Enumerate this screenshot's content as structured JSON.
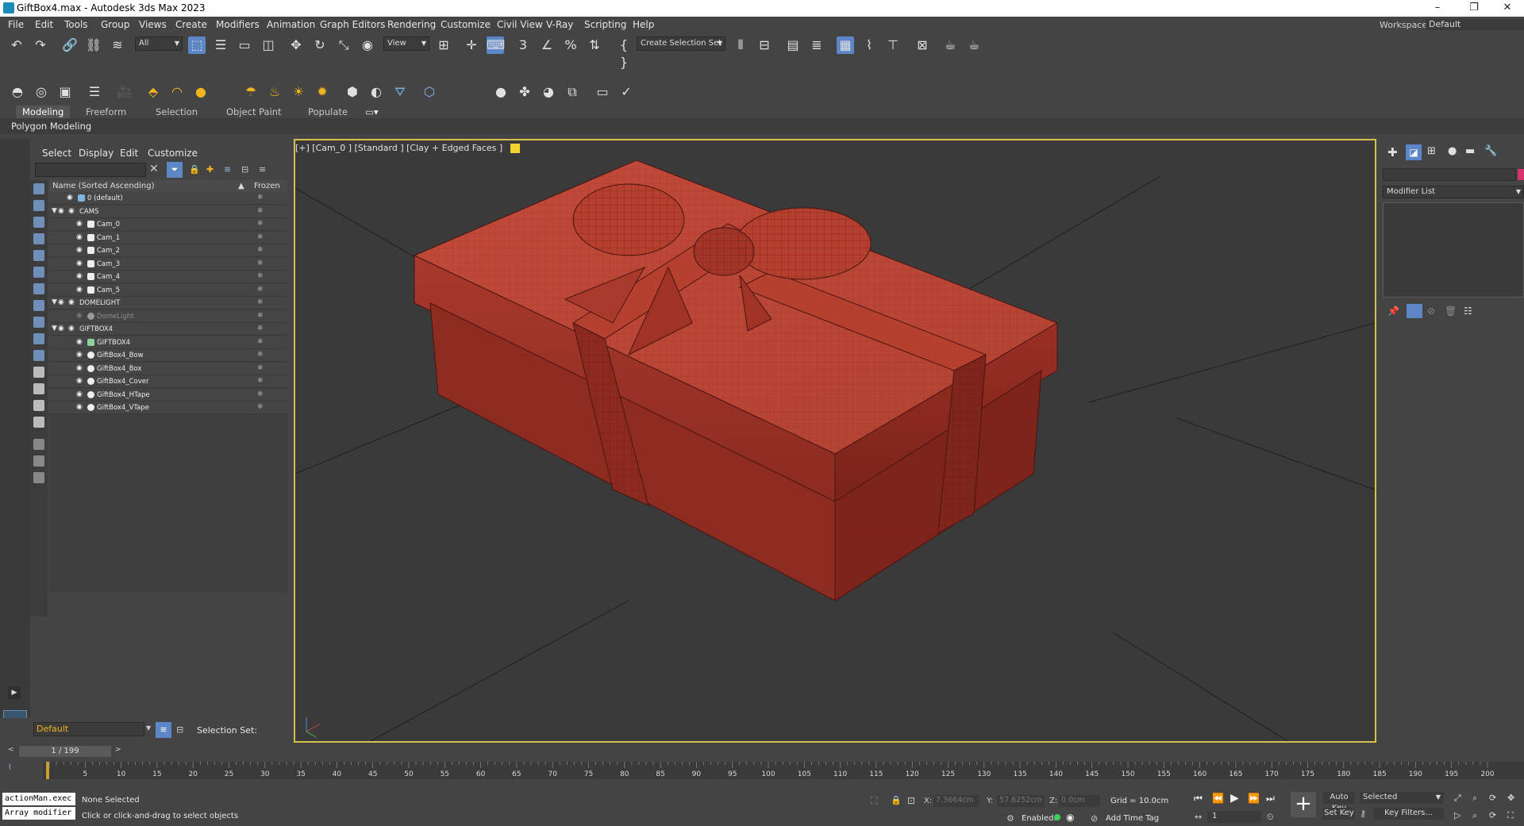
{
  "window": {
    "title": "GiftBox4.max - Autodesk 3ds Max 2023",
    "controls": [
      "–",
      "❐",
      "✕"
    ]
  },
  "menu": {
    "items": [
      "File",
      "Edit",
      "Tools",
      "Group",
      "Views",
      "Create",
      "Modifiers",
      "Animation",
      "Graph Editors",
      "Rendering",
      "Customize",
      "Civil View",
      "V-Ray",
      "Scripting",
      "Help"
    ],
    "workspaces_label": "Workspaces:",
    "workspaces_value": "Default"
  },
  "main_toolbar": {
    "filter_value": "All",
    "refcoord_value": "View",
    "selection_set_placeholder": "Create Selection Set"
  },
  "ribbon": {
    "tabs": [
      "Modeling",
      "Freeform",
      "Selection",
      "Object Paint",
      "Populate"
    ],
    "selected_tab": "Modeling",
    "panel_title": "Polygon Modeling"
  },
  "explorer": {
    "menus": [
      "Select",
      "Display",
      "Edit",
      "Customize"
    ],
    "column_name": "Name (Sorted Ascending)",
    "column_frozen": "Frozen",
    "rows": [
      {
        "label": "0 (default)"
      },
      {
        "label": "CAMS"
      },
      {
        "label": "Cam_0"
      },
      {
        "label": "Cam_1"
      },
      {
        "label": "Cam_2"
      },
      {
        "label": "Cam_3"
      },
      {
        "label": "Cam_4"
      },
      {
        "label": "Cam_5"
      },
      {
        "label": "DOMELIGHT"
      },
      {
        "label": "DomeLight"
      },
      {
        "label": "GIFTBOX4"
      },
      {
        "label": "GIFTBOX4"
      },
      {
        "label": "GiftBox4_Bow"
      },
      {
        "label": "GiftBox4_Box"
      },
      {
        "label": "GiftBox4_Cover"
      },
      {
        "label": "GiftBox4_HTape"
      },
      {
        "label": "GiftBox4_VTape"
      }
    ],
    "layer_value": "Default",
    "selection_set_label": "Selection Set:"
  },
  "viewport": {
    "label": "[+] [Cam_0 ] [Standard ] [Clay + Edged Faces ]",
    "box_color": "#b23a2c",
    "border_color": "#d4c24a"
  },
  "command_panel": {
    "modifier_list": "Modifier List"
  },
  "timeline": {
    "frame_display": "1 / 199",
    "ticks": [
      "5",
      "10",
      "15",
      "20",
      "25",
      "30",
      "35",
      "40",
      "45",
      "50",
      "55",
      "60",
      "65",
      "70",
      "75",
      "80",
      "85",
      "90",
      "95",
      "100",
      "105",
      "110",
      "115",
      "120",
      "125",
      "130",
      "135",
      "140",
      "145",
      "150",
      "155",
      "160",
      "165",
      "170",
      "175",
      "180",
      "185",
      "190",
      "195",
      "200"
    ]
  },
  "status": {
    "script_line1": "actionMan.exec",
    "script_line2": "Array modifier",
    "selection_status": "None Selected",
    "prompt": "Click or click-and-drag to select objects",
    "x_label": "X:",
    "x_value": "7.3664cm",
    "y_label": "Y:",
    "y_value": "57.6252cm",
    "z_label": "Z:",
    "z_value": "0.0cm",
    "grid": "Grid = 10.0cm",
    "enabled_label": "Enabled:",
    "add_time_tag": "Add Time Tag",
    "auto_key": "Auto Key",
    "selected_value": "Selected",
    "set_key": "Set Key",
    "key_filters": "Key Filters...",
    "frame_value": "1"
  }
}
